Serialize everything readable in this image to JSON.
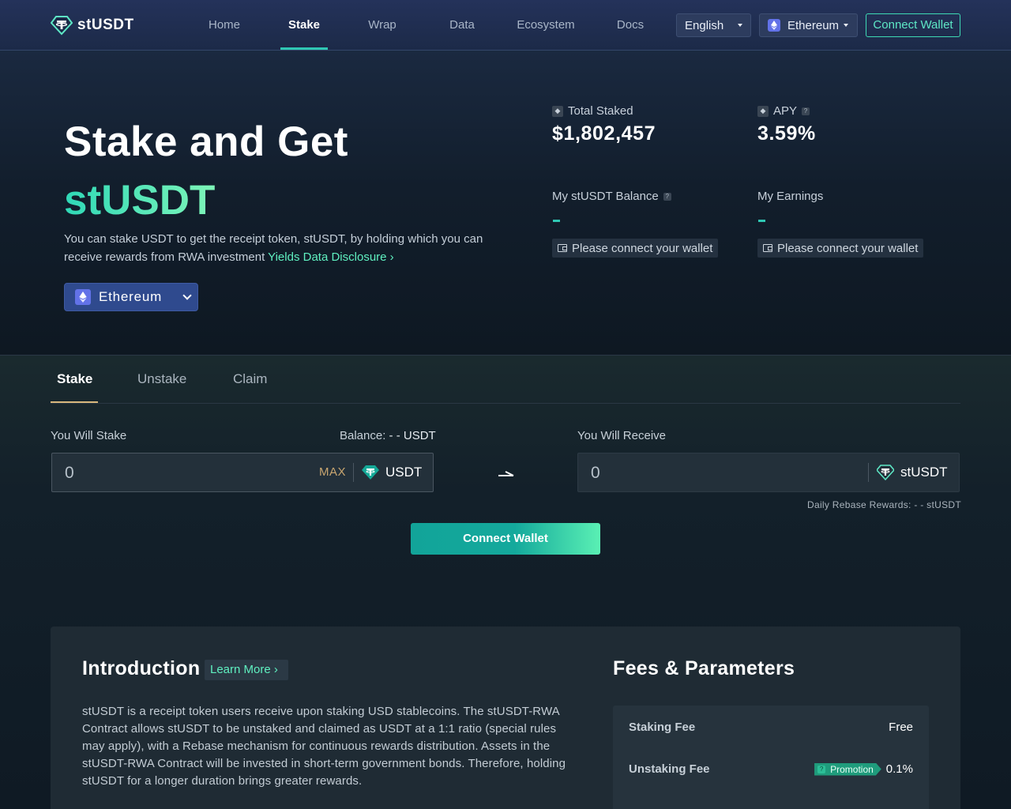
{
  "nav": {
    "logo_text": "stUSDT",
    "links": [
      {
        "label": "Home"
      },
      {
        "label": "Stake"
      },
      {
        "label": "Wrap"
      },
      {
        "label": "Data"
      },
      {
        "label": "Ecosystem"
      },
      {
        "label": "Docs"
      }
    ],
    "active_link": "Stake",
    "language": "English",
    "network": "Ethereum",
    "connect_label": "Connect Wallet"
  },
  "hero": {
    "title": "Stake and Get",
    "token": "stUSDT",
    "desc_text": "You can stake USDT to get the receipt token, stUSDT, by holding which you can receive rewards from RWA investment",
    "desc_link": "Yields Data Disclosure",
    "chain_button": "Ethereum"
  },
  "stats": {
    "total_staked_label": "Total Staked",
    "total_staked_value": "$1,802,457",
    "apy_label": "APY",
    "apy_value": "3.59%",
    "balance_label": "My stUSDT Balance",
    "earnings_label": "My Earnings",
    "wallet_prompt": "Please connect your wallet"
  },
  "stake": {
    "tabs": [
      {
        "label": "Stake"
      },
      {
        "label": "Unstake"
      },
      {
        "label": "Claim"
      }
    ],
    "active_tab": "Stake",
    "stake_label": "You Will Stake",
    "balance_label": "Balance:",
    "balance_value": "- - USDT",
    "stake_input_value": "0",
    "max_label": "MAX",
    "stake_token": "USDT",
    "receive_label": "You Will Receive",
    "receive_input_value": "0",
    "receive_token": "stUSDT",
    "rebase_text": "Daily Rebase Rewards: - - stUSDT",
    "connect_label": "Connect Wallet"
  },
  "intro": {
    "title": "Introduction",
    "learn_more": "Learn More",
    "text": "stUSDT is a receipt token users receive upon staking USD stablecoins. The stUSDT-RWA Contract allows stUSDT to be unstaked and claimed as USDT at a 1:1 ratio (special rules may apply), with a Rebase mechanism for continuous rewards distribution. Assets in the stUSDT-RWA Contract will be invested in short-term government bonds. Therefore, holding stUSDT for a longer duration brings greater rewards."
  },
  "fees": {
    "title": "Fees & Parameters",
    "rows": [
      {
        "label": "Staking Fee",
        "value": "Free"
      },
      {
        "label": "Unstaking Fee",
        "badge": "Promotion",
        "value": "0.1%"
      }
    ]
  },
  "colors": {
    "accent": "#2fc7b3",
    "accent_light": "#5ff0c0",
    "nav_bg": "#24325a",
    "tab_underline": "#d9b77c",
    "max_color": "#c9a670"
  }
}
